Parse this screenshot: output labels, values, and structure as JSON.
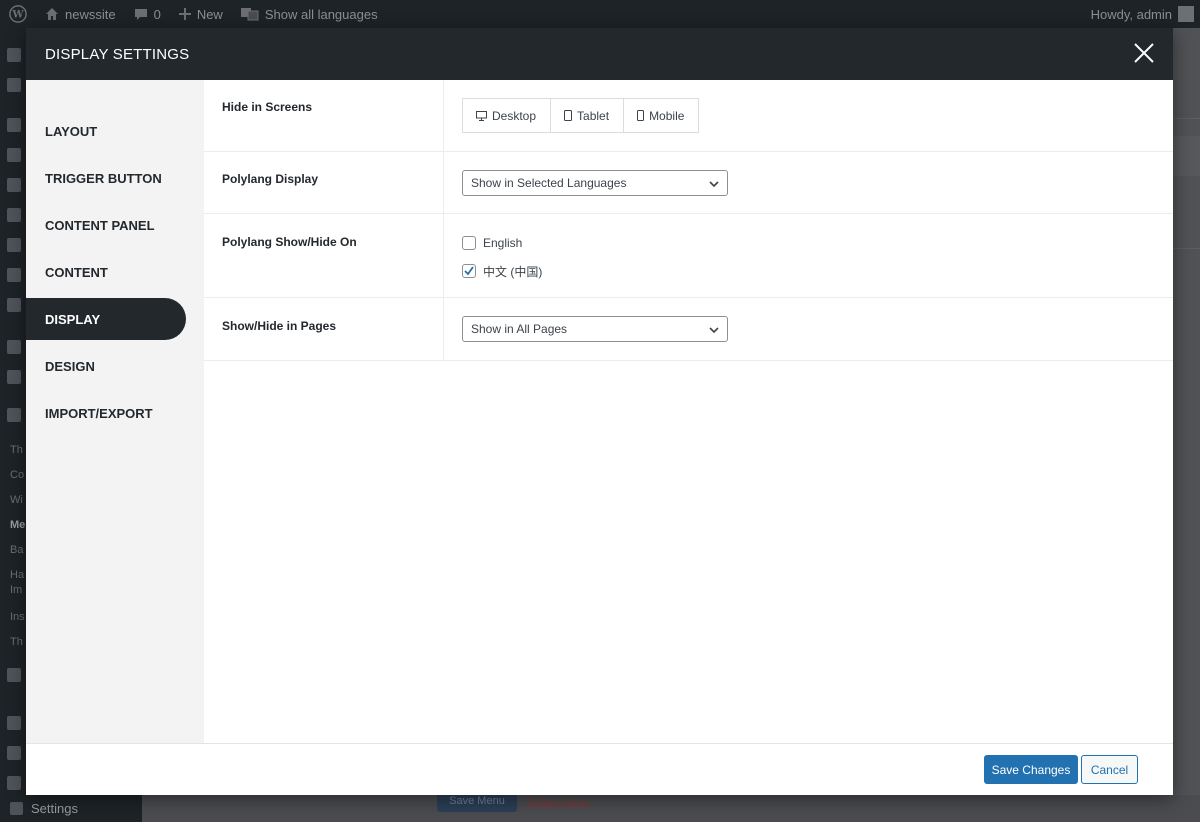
{
  "admin_bar": {
    "site_name": "newssite",
    "comments_count": "0",
    "new_label": "New",
    "languages_label": "Show all languages",
    "greeting": "Howdy, admin"
  },
  "admin_menu": {
    "visible_fragments": [
      "Th",
      "Co",
      "Wi",
      "Me",
      "Ba",
      "Ha",
      "Im",
      "Ins",
      "Th"
    ],
    "settings_label": "Settings"
  },
  "background": {
    "save_menu_label": "Save Menu",
    "delete_link_label": "Delete Menu"
  },
  "modal": {
    "title": "DISPLAY SETTINGS",
    "nav": [
      {
        "label": "LAYOUT",
        "active": false
      },
      {
        "label": "TRIGGER BUTTON",
        "active": false
      },
      {
        "label": "CONTENT PANEL",
        "active": false
      },
      {
        "label": "CONTENT",
        "active": false
      },
      {
        "label": "DISPLAY",
        "active": true
      },
      {
        "label": "DESIGN",
        "active": false
      },
      {
        "label": "IMPORT/EXPORT",
        "active": false
      }
    ],
    "settings": {
      "hide_in_screens": {
        "label": "Hide in Screens",
        "options": [
          "Desktop",
          "Tablet",
          "Mobile"
        ]
      },
      "polylang_display": {
        "label": "Polylang Display",
        "value": "Show in Selected Languages"
      },
      "polylang_show_hide_on": {
        "label": "Polylang Show/Hide On",
        "languages": [
          {
            "label": "English",
            "checked": false
          },
          {
            "label": "中文 (中国)",
            "checked": true
          }
        ]
      },
      "show_hide_in_pages": {
        "label": "Show/Hide in Pages",
        "value": "Show in All Pages"
      }
    },
    "footer": {
      "save_label": "Save Changes",
      "cancel_label": "Cancel"
    }
  },
  "colors": {
    "dark": "#23282d",
    "accent": "#2271b1",
    "sidebar_bg": "#f3f3f4"
  }
}
